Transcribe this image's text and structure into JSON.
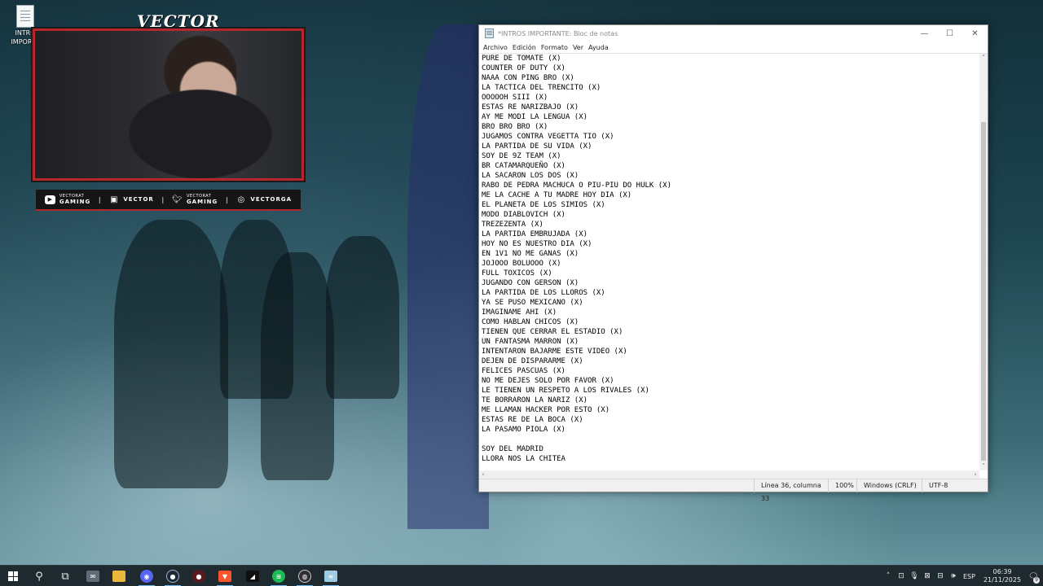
{
  "desktop": {
    "icon_label_line1": "INTRO",
    "icon_label_line2": "IMPORTA"
  },
  "stream_overlay": {
    "name": "VECTOR",
    "socials": [
      {
        "icon": "youtube-icon",
        "small": "VECTORAT",
        "big": "GAMING"
      },
      {
        "icon": "twitch-icon",
        "text": "VECTOR"
      },
      {
        "icon": "twitter-icon",
        "small": "VECTORAT",
        "big": "GAMING"
      },
      {
        "icon": "instagram-icon",
        "text": "VECTORGA"
      }
    ],
    "accent_color": "#b3272d"
  },
  "notepad": {
    "title": "*INTROS IMPORTANTE: Bloc de notas",
    "menu": [
      "Archivo",
      "Edición",
      "Formato",
      "Ver",
      "Ayuda"
    ],
    "lines": [
      "PURE DE TOMATE (X)",
      "COUNTER OF DUTY (X)",
      "NAAA CON PING BRO (X)",
      "LA TACTICA DEL TRENCITO (X)",
      "OOOOOH SIII (X)",
      "ESTAS RE NARIZBAJO (X)",
      "AY ME MODI LA LENGUA (X)",
      "BRO BRO BRO (X)",
      "JUGAMOS CONTRA VEGETTA TIO (X)",
      "LA PARTIDA DE SU VIDA (X)",
      "SOY DE 9Z TEAM (X)",
      "BR CATAMARQUEÑO (X)",
      "LA SACARON LOS DOS (X)",
      "RABO DE PEDRA MACHUCA O PIU-PIU DO HULK (X)",
      "ME LA CACHE A TU MADRE HOY DIA (X)",
      "EL PLANETA DE LOS SIMIOS (X)",
      "MODO DIABLOVICH (X)",
      "TREZEZENTA (X)",
      "LA PARTIDA EMBRUJADA (X)",
      "HOY NO ES NUESTRO DIA (X)",
      "EN 1V1 NO ME GANAS (X)",
      "JOJOOO BOLUOOO (X)",
      "FULL TOXICOS (X)",
      "JUGANDO CON GERSON (X)",
      "LA PARTIDA DE LOS LLOROS (X)",
      "YA SE PUSO MEXICANO (X)",
      "IMAGINAME AHI (X)",
      "COMO HABLAN CHICOS (X)",
      "TIENEN QUE CERRAR EL ESTADIO (X)",
      "UN FANTASMA MARRON (X)",
      "INTENTARON BAJARME ESTE VIDEO (X)",
      "DEJEN DE DISPARARME (X)",
      "FELICES PASCUAS (X)",
      "NO ME DEJES SOLO POR FAVOR (X)",
      "LE TIENEN UN RESPETO A LOS RIVALES (X)",
      "TE BORRARON LA NARIZ (X)",
      "ME LLAMAN HACKER POR ESTO (X)",
      "ESTAS RE DE LA BOCA (X)",
      "LA PASAMO PIOLA (X)",
      "",
      "SOY DEL MADRID",
      "LLORA NOS LA CHITEA"
    ],
    "status": {
      "position": "Línea 36, columna 33",
      "zoom": "100%",
      "line_endings": "Windows (CRLF)",
      "encoding": "UTF-8"
    }
  },
  "taskbar": {
    "apps": [
      {
        "name": "start-button",
        "icon": "windows-logo-icon"
      },
      {
        "name": "search-button",
        "icon": "search-icon"
      },
      {
        "name": "task-view-button",
        "icon": "task-view-icon"
      },
      {
        "name": "taskbar-app-mail",
        "icon": "mail-icon"
      },
      {
        "name": "taskbar-app-explorer",
        "icon": "folder-icon"
      },
      {
        "name": "taskbar-app-discord",
        "icon": "discord-icon"
      },
      {
        "name": "taskbar-app-steam",
        "icon": "steam-icon"
      },
      {
        "name": "taskbar-app-obs",
        "icon": "record-icon"
      },
      {
        "name": "taskbar-app-brave",
        "icon": "brave-icon"
      },
      {
        "name": "taskbar-app-riot",
        "icon": "game-icon"
      },
      {
        "name": "taskbar-app-spotify",
        "icon": "spotify-icon"
      },
      {
        "name": "taskbar-app-obs-studio",
        "icon": "obs-icon"
      },
      {
        "name": "taskbar-app-notepad",
        "icon": "notepad-icon"
      }
    ],
    "language": "ESP",
    "time": "06:39",
    "date": "21/11/2025",
    "notification_count": "9"
  }
}
